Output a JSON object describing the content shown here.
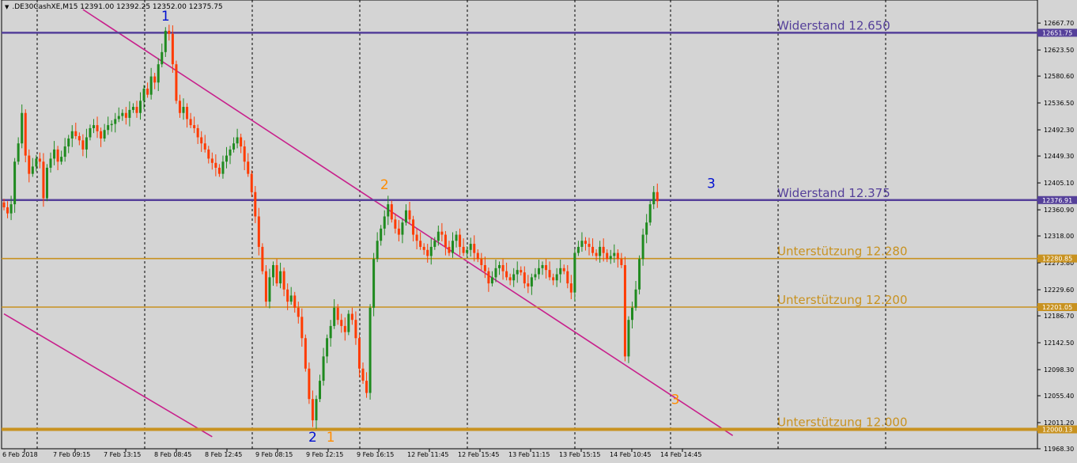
{
  "header": {
    "menu_icon": "triangle-down-icon",
    "text": ".DE30CashXE,M15  12391.00 12392.25 12352.00 12375.75"
  },
  "colors": {
    "background": "#d4d4d4",
    "bull": "#1f8a1f",
    "bear": "#ff3b00",
    "resistance": "#55409a",
    "support": "#c89220",
    "trend": "#c8208c",
    "wave_blue": "#0010d0",
    "wave_orange": "#ff8c00"
  },
  "chart_data": {
    "type": "candlestick",
    "symbol": "DE30CashXE",
    "timeframe": "M15",
    "ylim": [
      11968.3,
      12690
    ],
    "y_ticks": [
      "12667.70",
      "12623.50",
      "12580.60",
      "12536.50",
      "12492.30",
      "12449.30",
      "12405.10",
      "12360.90",
      "12318.00",
      "12273.80",
      "12229.60",
      "12186.70",
      "12142.50",
      "12098.30",
      "12055.40",
      "12011.20",
      "11968.30"
    ],
    "x_ticks": [
      "6 Feb 2018",
      "7 Feb 09:15",
      "7 Feb 13:15",
      "8 Feb 08:45",
      "8 Feb 12:45",
      "9 Feb 08:15",
      "9 Feb 12:15",
      "9 Feb 16:15",
      "12 Feb 11:45",
      "12 Feb 15:45",
      "13 Feb 11:15",
      "13 Feb 15:15",
      "14 Feb 10:45",
      "14 Feb 14:45"
    ],
    "candles_close": [
      12365,
      12355,
      12370,
      12440,
      12470,
      12520,
      12450,
      12420,
      12432,
      12445,
      12440,
      12380,
      12430,
      12445,
      12460,
      12440,
      12448,
      12465,
      12478,
      12490,
      12482,
      12475,
      12460,
      12480,
      12495,
      12500,
      12490,
      12478,
      12492,
      12500,
      12502,
      12510,
      12515,
      12520,
      12512,
      12525,
      12530,
      12520,
      12540,
      12560,
      12550,
      12580,
      12570,
      12600,
      12620,
      12655,
      12650,
      12600,
      12540,
      12520,
      12530,
      12510,
      12500,
      12495,
      12480,
      12470,
      12460,
      12445,
      12438,
      12430,
      12420,
      12440,
      12450,
      12460,
      12470,
      12480,
      12465,
      12440,
      12420,
      12390,
      12350,
      12300,
      12260,
      12210,
      12250,
      12270,
      12240,
      12260,
      12230,
      12210,
      12220,
      12200,
      12185,
      12150,
      12100,
      12050,
      12015,
      12050,
      12080,
      12120,
      12150,
      12170,
      12200,
      12180,
      12170,
      12160,
      12190,
      12180,
      12150,
      12100,
      12080,
      12060,
      12200,
      12280,
      12310,
      12330,
      12350,
      12370,
      12345,
      12330,
      12320,
      12340,
      12360,
      12345,
      12320,
      12310,
      12300,
      12295,
      12285,
      12300,
      12310,
      12325,
      12320,
      12300,
      12290,
      12310,
      12320,
      12300,
      12290,
      12295,
      12305,
      12290,
      12280,
      12270,
      12260,
      12240,
      12250,
      12265,
      12270,
      12260,
      12250,
      12245,
      12255,
      12262,
      12258,
      12240,
      12235,
      12250,
      12255,
      12265,
      12270,
      12262,
      12250,
      12245,
      12255,
      12265,
      12260,
      12240,
      12225,
      12290,
      12300,
      12310,
      12305,
      12300,
      12290,
      12285,
      12300,
      12290,
      12280,
      12285,
      12290,
      12280,
      12270,
      12120,
      12180,
      12200,
      12230,
      12280,
      12320,
      12340,
      12370,
      12390,
      12375
    ],
    "horizontal_levels": [
      {
        "value": 12651.75,
        "kind": "resistance",
        "label": "Widerstand 12.650",
        "price_tag": "12651.75"
      },
      {
        "value": 12376.91,
        "kind": "resistance",
        "label": "Widerstand 12.375",
        "price_tag": "12376.91"
      },
      {
        "value": 12280.85,
        "kind": "support",
        "label": "Unterstützung 12.280",
        "price_tag": "12280.85"
      },
      {
        "value": 12201.05,
        "kind": "support",
        "label": "Unterstützung 12.200",
        "price_tag": "12201.05"
      },
      {
        "value": 12000.13,
        "kind": "support",
        "label": "Unterstützung 12.000",
        "price_tag": "12000.13"
      }
    ],
    "wave_labels": [
      {
        "text": "1",
        "color": "blue",
        "candle": 45,
        "price": 12672
      },
      {
        "text": "2",
        "color": "blue",
        "candle": 86,
        "price": 11980
      },
      {
        "text": "1",
        "color": "orange",
        "candle": 91,
        "price": 11980
      },
      {
        "text": "2",
        "color": "orange",
        "candle": 106,
        "price": 12395
      },
      {
        "text": "3",
        "color": "orange",
        "candle": 187,
        "price": 12042
      },
      {
        "text": "3",
        "color": "blue",
        "candle": 197,
        "price": 12397
      }
    ],
    "trendlines": [
      {
        "from": {
          "candle": 22,
          "price": 12690
        },
        "to": {
          "candle": 203,
          "price": 11990
        }
      },
      {
        "from": {
          "candle": 0,
          "price": 12190
        },
        "to": {
          "candle": 58,
          "price": 11988
        }
      }
    ]
  }
}
